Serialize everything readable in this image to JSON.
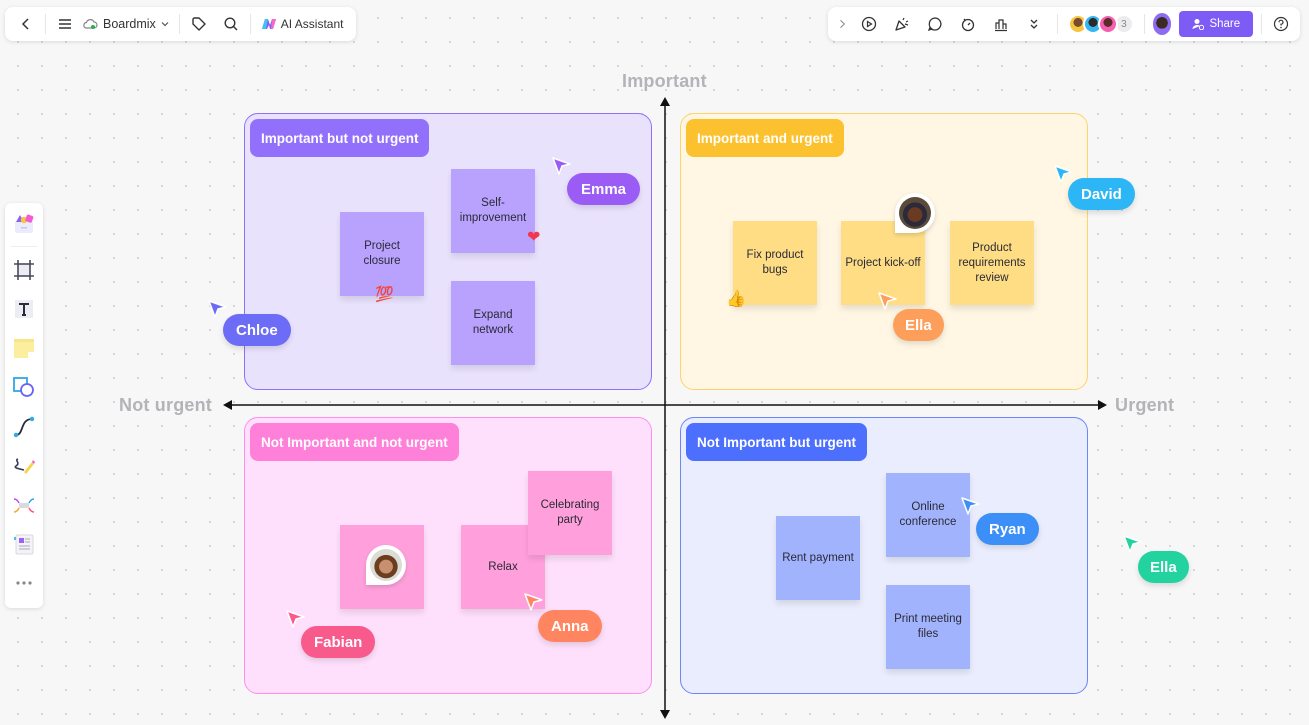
{
  "top_left_toolbar": {
    "back_icon": "chevron-left-icon",
    "menu_icon": "hamburger-menu-icon",
    "workspace_name": "Boardmix",
    "cloud_icon": "cloud-synced-icon",
    "tag_icon": "tag-icon",
    "search_icon": "search-icon",
    "ai_label": "AI Assistant"
  },
  "top_right_toolbar": {
    "expand_icon": "chevron-right-icon",
    "present_icon": "play-circle-icon",
    "celebrate_icon": "party-popper-icon",
    "comment_icon": "comment-icon",
    "timer_icon": "timer-icon",
    "vote_icon": "bar-chart-icon",
    "more_icon": "double-chevron-down-icon",
    "collaborator_count": "3",
    "share_label": "Share",
    "help_icon": "help-circle-icon"
  },
  "sidebar": {
    "items": [
      {
        "name": "templates",
        "icon": "templates-icon"
      },
      {
        "name": "frame",
        "icon": "frame-icon"
      },
      {
        "name": "text",
        "icon": "text-icon"
      },
      {
        "name": "sticky-note",
        "icon": "sticky-note-icon"
      },
      {
        "name": "shapes",
        "icon": "shapes-icon"
      },
      {
        "name": "connector",
        "icon": "connector-icon"
      },
      {
        "name": "pen",
        "icon": "pen-icon"
      },
      {
        "name": "mind-map",
        "icon": "mind-map-icon"
      },
      {
        "name": "document",
        "icon": "document-icon"
      },
      {
        "name": "more",
        "icon": "more-horizontal-icon"
      }
    ]
  },
  "axes": {
    "top": "Important",
    "left": "Not urgent",
    "right": "Urgent"
  },
  "quadrants": {
    "top_left": {
      "title": "Important but not urgent",
      "color": "#9370fb",
      "notes": [
        "Project closure",
        "Self-improvement",
        "Expand network"
      ]
    },
    "top_right": {
      "title": "Important and urgent",
      "color": "#fcc12e",
      "notes": [
        "Fix product bugs",
        "Project kick-off",
        "Product requirements review"
      ]
    },
    "bottom_left": {
      "title": "Not Important and not urgent",
      "color": "#ff80d9",
      "notes": [
        "",
        "Relax",
        "Celebrating party"
      ]
    },
    "bottom_right": {
      "title": "Not Important but urgent",
      "color": "#4c6ffe",
      "notes": [
        "Rent payment",
        "Online conference",
        "Print meeting files"
      ]
    }
  },
  "reactions": {
    "hundred": "💯",
    "heart": "❤",
    "thumbs_up": "👍"
  },
  "collaborators": [
    {
      "name": "Emma",
      "color": "#9b5cf5"
    },
    {
      "name": "Chloe",
      "color": "#6c6cf7"
    },
    {
      "name": "David",
      "color": "#2cb6f5"
    },
    {
      "name": "Ella",
      "color": "#fd9f5b"
    },
    {
      "name": "Fabian",
      "color": "#f95a8c"
    },
    {
      "name": "Anna",
      "color": "#ff8560"
    },
    {
      "name": "Ryan",
      "color": "#3c8ff6"
    },
    {
      "name": "Ella",
      "color": "#22d3a0"
    }
  ]
}
